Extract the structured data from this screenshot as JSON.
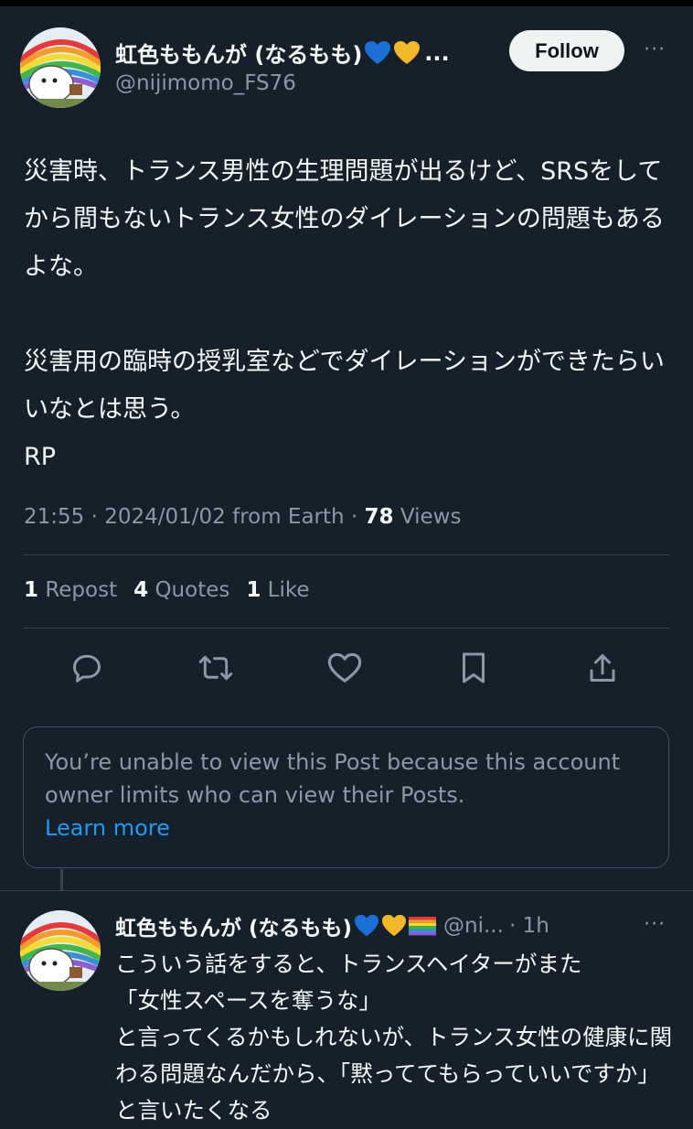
{
  "tweet": {
    "display_name": "虹色ももんが (なるもも)",
    "truncation": "...",
    "handle": "@nijimomo_FS76",
    "follow_label": "Follow",
    "more_label": "···",
    "body": "災害時、トランス男性の生理問題が出るけど、SRSをしてから間もないトランス女性のダイレーションの問題もあるよな。\n\n災害用の臨時の授乳室などでダイレーションができたらいいなとは思う。\nRP",
    "meta_prefix": "21:55 · 2024/01/02 from Earth · ",
    "views_count": "78",
    "views_label": " Views",
    "reposts_count": "1",
    "reposts_label": "Repost",
    "quotes_count": "4",
    "quotes_label": "Quotes",
    "likes_count": "1",
    "likes_label": "Like",
    "actions": [
      "reply-icon",
      "repost-icon",
      "like-icon",
      "bookmark-icon",
      "share-icon"
    ]
  },
  "notice": {
    "text": "You’re unable to view this Post because this account owner limits who can view their Posts.",
    "link": "Learn more"
  },
  "reply": {
    "display_name": "虹色ももんが (なるもも)",
    "handle": "@ni...",
    "time": "· 1h",
    "more_label": "···",
    "body": "こういう話をすると、トランスヘイターがまた\n「女性スペースを奪うな」\nと言ってくるかもしれないが、トランス女性の健康に関わる問題なんだから、「黙っててもらっていいですか」と言いたくなる"
  },
  "colors": {
    "background": "#15202b",
    "text": "#f7f9f9",
    "muted": "#8b98a5",
    "link": "#1d9bf0",
    "divider": "#38444d"
  }
}
